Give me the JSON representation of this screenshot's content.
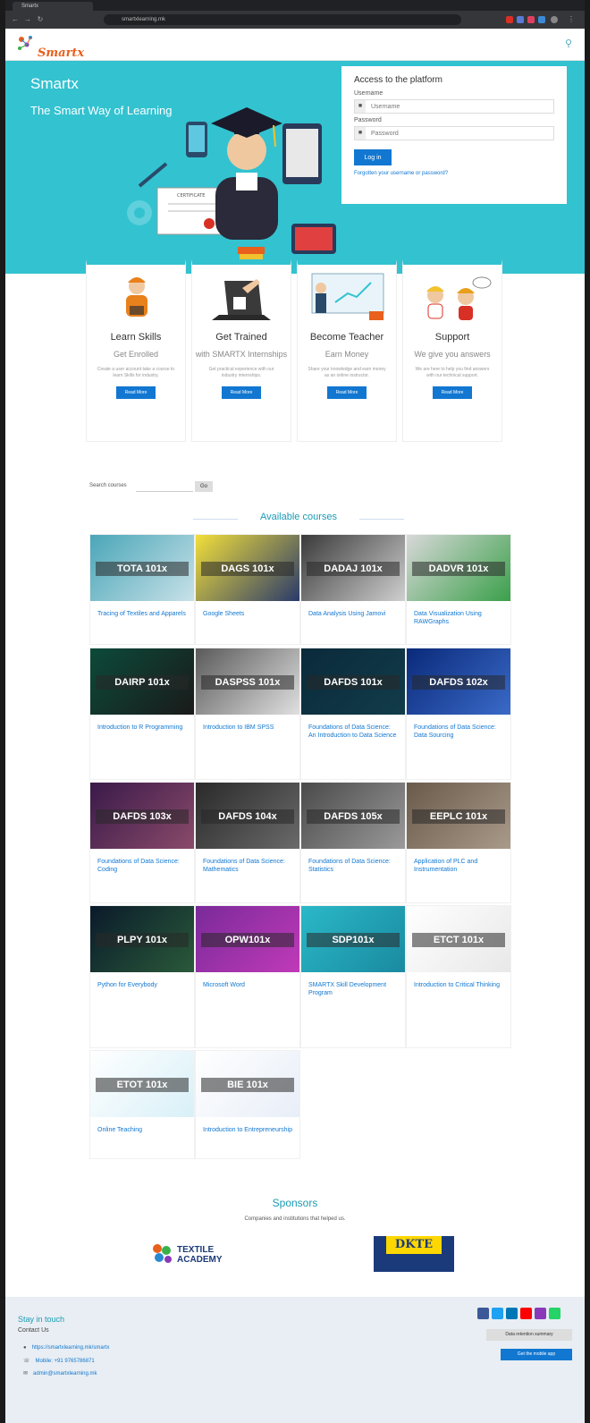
{
  "browser": {
    "tab_title": "Smartx",
    "url": "smartxlearning.mk"
  },
  "site": {
    "logo_text": "Smartx",
    "hero_title": "Smartx",
    "hero_subtitle": "The Smart Way of Learning",
    "hero_certificate_text": "CERTIFICATE"
  },
  "login": {
    "title": "Access to the platform",
    "username_label": "Username",
    "username_placeholder": "Username",
    "password_label": "Password",
    "password_placeholder": "Password",
    "login_button": "Log in",
    "forgot_link": "Forgotten your username or password?"
  },
  "features": [
    {
      "title": "Learn Skills",
      "subtitle": "Get Enrolled",
      "desc": "Create a user account take a course to learn Skills for industry.",
      "button": "Read More"
    },
    {
      "title": "Get Trained",
      "subtitle": "with SMARTX Internships",
      "desc": "Get practical experience with our industry internships.",
      "button": "Read More"
    },
    {
      "title": "Become Teacher",
      "subtitle": "Earn Money",
      "desc": "Share your knowledge and earn money as an online instructor.",
      "button": "Read More"
    },
    {
      "title": "Support",
      "subtitle": "We give you answers",
      "desc": "We are here to help you find answers with our technical support.",
      "button": "Read More"
    }
  ],
  "search": {
    "label": "Search courses",
    "button": "Go"
  },
  "courses_heading": "Available courses",
  "courses": [
    {
      "code": "TOTA 101x",
      "name": "Tracing of Textiles and Apparels",
      "colors": [
        "#4aa6b8",
        "#c8e1e8"
      ]
    },
    {
      "code": "DAGS 101x",
      "name": "Google Sheets",
      "colors": [
        "#f2df3a",
        "#2a3a6a"
      ]
    },
    {
      "code": "DADAJ 101x",
      "name": "Data Analysis Using Jamovi",
      "colors": [
        "#3a3a3a",
        "#cfcfcf"
      ]
    },
    {
      "code": "DADVR 101x",
      "name": "Data Visualization Using RAWGraphs",
      "colors": [
        "#d8d8d8",
        "#3aa04a"
      ]
    },
    {
      "code": "DAIRP 101x",
      "name": "Introduction to R Programming",
      "colors": [
        "#0c4a3a",
        "#1a1a1a"
      ]
    },
    {
      "code": "DASPSS 101x",
      "name": "Introduction to IBM SPSS",
      "colors": [
        "#5a5a5a",
        "#e0e0e0"
      ]
    },
    {
      "code": "DAFDS 101x",
      "name": "Foundations of Data Science: An Introduction to Data Science",
      "colors": [
        "#0a2a3a",
        "#123c4a"
      ]
    },
    {
      "code": "DAFDS 102x",
      "name": "Foundations of Data Science: Data Sourcing",
      "colors": [
        "#0a2a7a",
        "#3a6ac8"
      ]
    },
    {
      "code": "DAFDS 103x",
      "name": "Foundations of Data Science: Coding",
      "colors": [
        "#3a1a4a",
        "#8a4a6a"
      ]
    },
    {
      "code": "DAFDS 104x",
      "name": "Foundations of Data Science: Mathematics",
      "colors": [
        "#2a2a2a",
        "#6a6a6a"
      ]
    },
    {
      "code": "DAFDS 105x",
      "name": "Foundations of Data Science: Statistics",
      "colors": [
        "#4a4a4a",
        "#9a9a9a"
      ]
    },
    {
      "code": "EEPLC 101x",
      "name": "Application of PLC and Instrumentation",
      "colors": [
        "#6a5a4a",
        "#aa9a8a"
      ]
    },
    {
      "code": "PLPY 101x",
      "name": "Python for Everybody",
      "colors": [
        "#0a1a2a",
        "#2a5a3a"
      ]
    },
    {
      "code": "OPW101x",
      "name": "Microsoft Word",
      "colors": [
        "#7a2a9a",
        "#c03ab8"
      ]
    },
    {
      "code": "SDP101x",
      "name": "SMARTX Skill Development Program",
      "colors": [
        "#2ab8c8",
        "#1a8aa0"
      ]
    },
    {
      "code": "ETCT 101x",
      "name": "Introduction to Critical Thinking",
      "colors": [
        "#ffffff",
        "#e8e8e8"
      ]
    },
    {
      "code": "ETOT 101x",
      "name": "Online Teaching",
      "colors": [
        "#ffffff",
        "#d8f0f8"
      ]
    },
    {
      "code": "BIE 101x",
      "name": "Introduction to Entrepreneurship",
      "colors": [
        "#ffffff",
        "#e8eef8"
      ]
    }
  ],
  "sponsors": {
    "title": "Sponsors",
    "subtitle": "Companies and institutions that helped us.",
    "logo1_text": "TEXTILE ACADEMY",
    "logo2_text": "DKTE"
  },
  "footer": {
    "stay_in_touch": "Stay in touch",
    "contact_us": "Contact Us",
    "website": "https://smartxlearning.mk/smartx",
    "phone": "Mobile: +91 9765786871",
    "email": "admin@smartxlearning.mk",
    "data_retention": "Data retention summary",
    "mobile_app": "Get the mobile app"
  },
  "colors": {
    "accent": "#33c2d0",
    "link": "#1177d1",
    "logo": "#e8601c"
  }
}
